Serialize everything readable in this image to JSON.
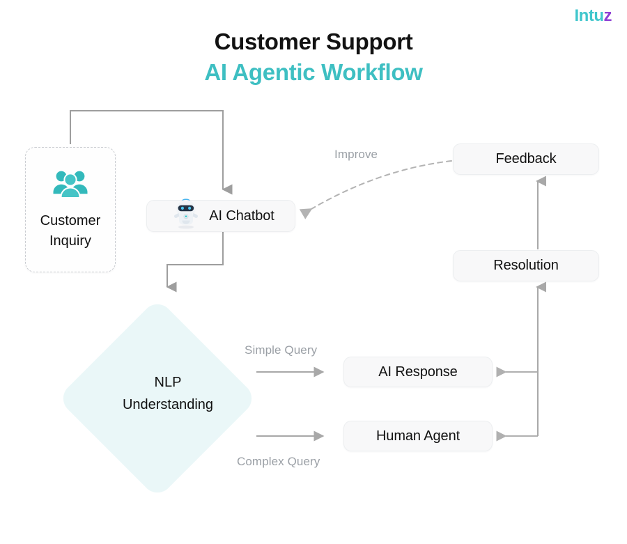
{
  "brand": {
    "name_main": "Intu",
    "name_accent": "z",
    "color_main": "#3fc6cc",
    "color_accent": "#8e3fd4"
  },
  "heading": {
    "line1": "Customer Support",
    "line2": "AI Agentic Workflow",
    "line1_color": "#121212",
    "line2_color": "#3ebfc2"
  },
  "theme": {
    "accent_teal": "#3ebfc2",
    "diamond_fill": "#eaf7f8",
    "box_fill": "#f8f8f9",
    "connector_gray": "#9e9e9e",
    "label_gray": "#9ba0a6"
  },
  "nodes": {
    "customer_inquiry": {
      "label_line1": "Customer",
      "label_line2": "Inquiry",
      "icon": "people-group-icon",
      "shape": "dashed-card"
    },
    "ai_chatbot": {
      "label": "AI Chatbot",
      "icon": "robot-icon",
      "shape": "rounded-box"
    },
    "nlp_understanding": {
      "label_line1": "NLP",
      "label_line2": "Understanding",
      "shape": "diamond"
    },
    "ai_response": {
      "label": "AI Response",
      "shape": "rounded-box"
    },
    "human_agent": {
      "label": "Human Agent",
      "shape": "rounded-box"
    },
    "resolution": {
      "label": "Resolution",
      "shape": "rounded-box"
    },
    "feedback": {
      "label": "Feedback",
      "shape": "rounded-box"
    }
  },
  "edge_labels": {
    "simple_query": "Simple Query",
    "complex_query": "Complex Query",
    "improve": "Improve"
  }
}
